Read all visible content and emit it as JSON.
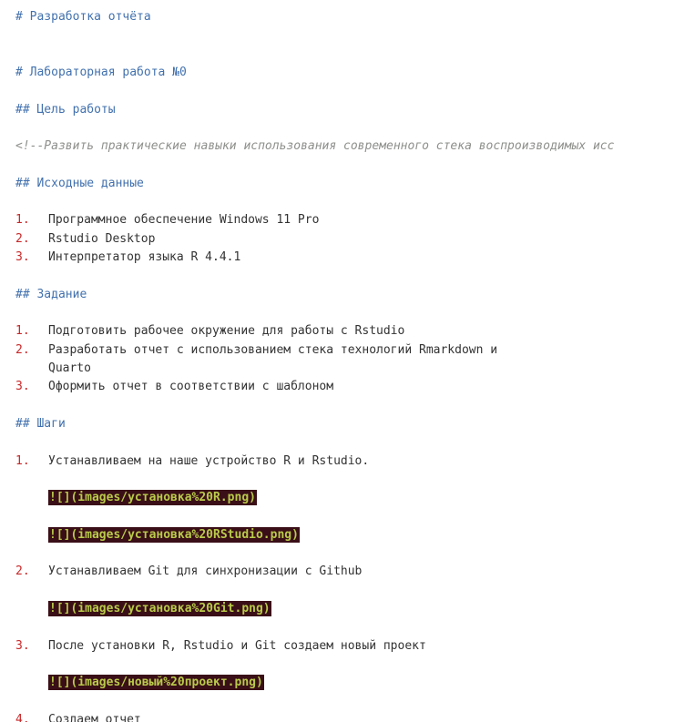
{
  "doc": {
    "title": "# Разработка отчёта",
    "lab_title": "# Лабораторная работа №0",
    "goal_heading": "## Цель работы",
    "goal_comment": "<!--Развить практические навыки использования современного стека воспроизводимых исс",
    "data_heading": "## Исходные данные",
    "data_items": [
      {
        "num": "1.",
        "text": "Программное обеспечение Windows 11 Pro"
      },
      {
        "num": "2.",
        "text": "Rstudio Desktop"
      },
      {
        "num": "3.",
        "text": "Интерпретатор языка R 4.4.1"
      }
    ],
    "task_heading": "## Задание",
    "task_items": [
      {
        "num": "1.",
        "text": "Подготовить рабочее окружение для работы с Rstudio"
      },
      {
        "num": "2.",
        "text": "Разработать отчет с использованием стека технологий Rmarkdown и",
        "cont": "Quarto"
      },
      {
        "num": "3.",
        "text": "Оформить отчет в соответствии с шаблоном"
      }
    ],
    "steps_heading": "## Шаги",
    "steps": [
      {
        "num": "1.",
        "text": "Устанавливаем на наше устройство R и Rstudio.",
        "images": [
          "![](images/установка%20R.png)",
          "![](images/установка%20RStudio.png)"
        ]
      },
      {
        "num": "2.",
        "text": "Устанавливаем Git для синхронизации с Github",
        "images": [
          "![](images/установка%20Git.png)"
        ]
      },
      {
        "num": "3.",
        "text": "После установки R, Rstudio и Git создаем новый проект",
        "images": [
          "![](images/новый%20проект.png)"
        ]
      },
      {
        "num": "4.",
        "text": "Создаем отчет"
      }
    ]
  },
  "colors": {
    "heading": "#4271ae",
    "list_number": "#c82829",
    "comment": "#8e908c",
    "image_link_bg": "#3a0f17",
    "image_link_fg": "#b9ca4a"
  }
}
